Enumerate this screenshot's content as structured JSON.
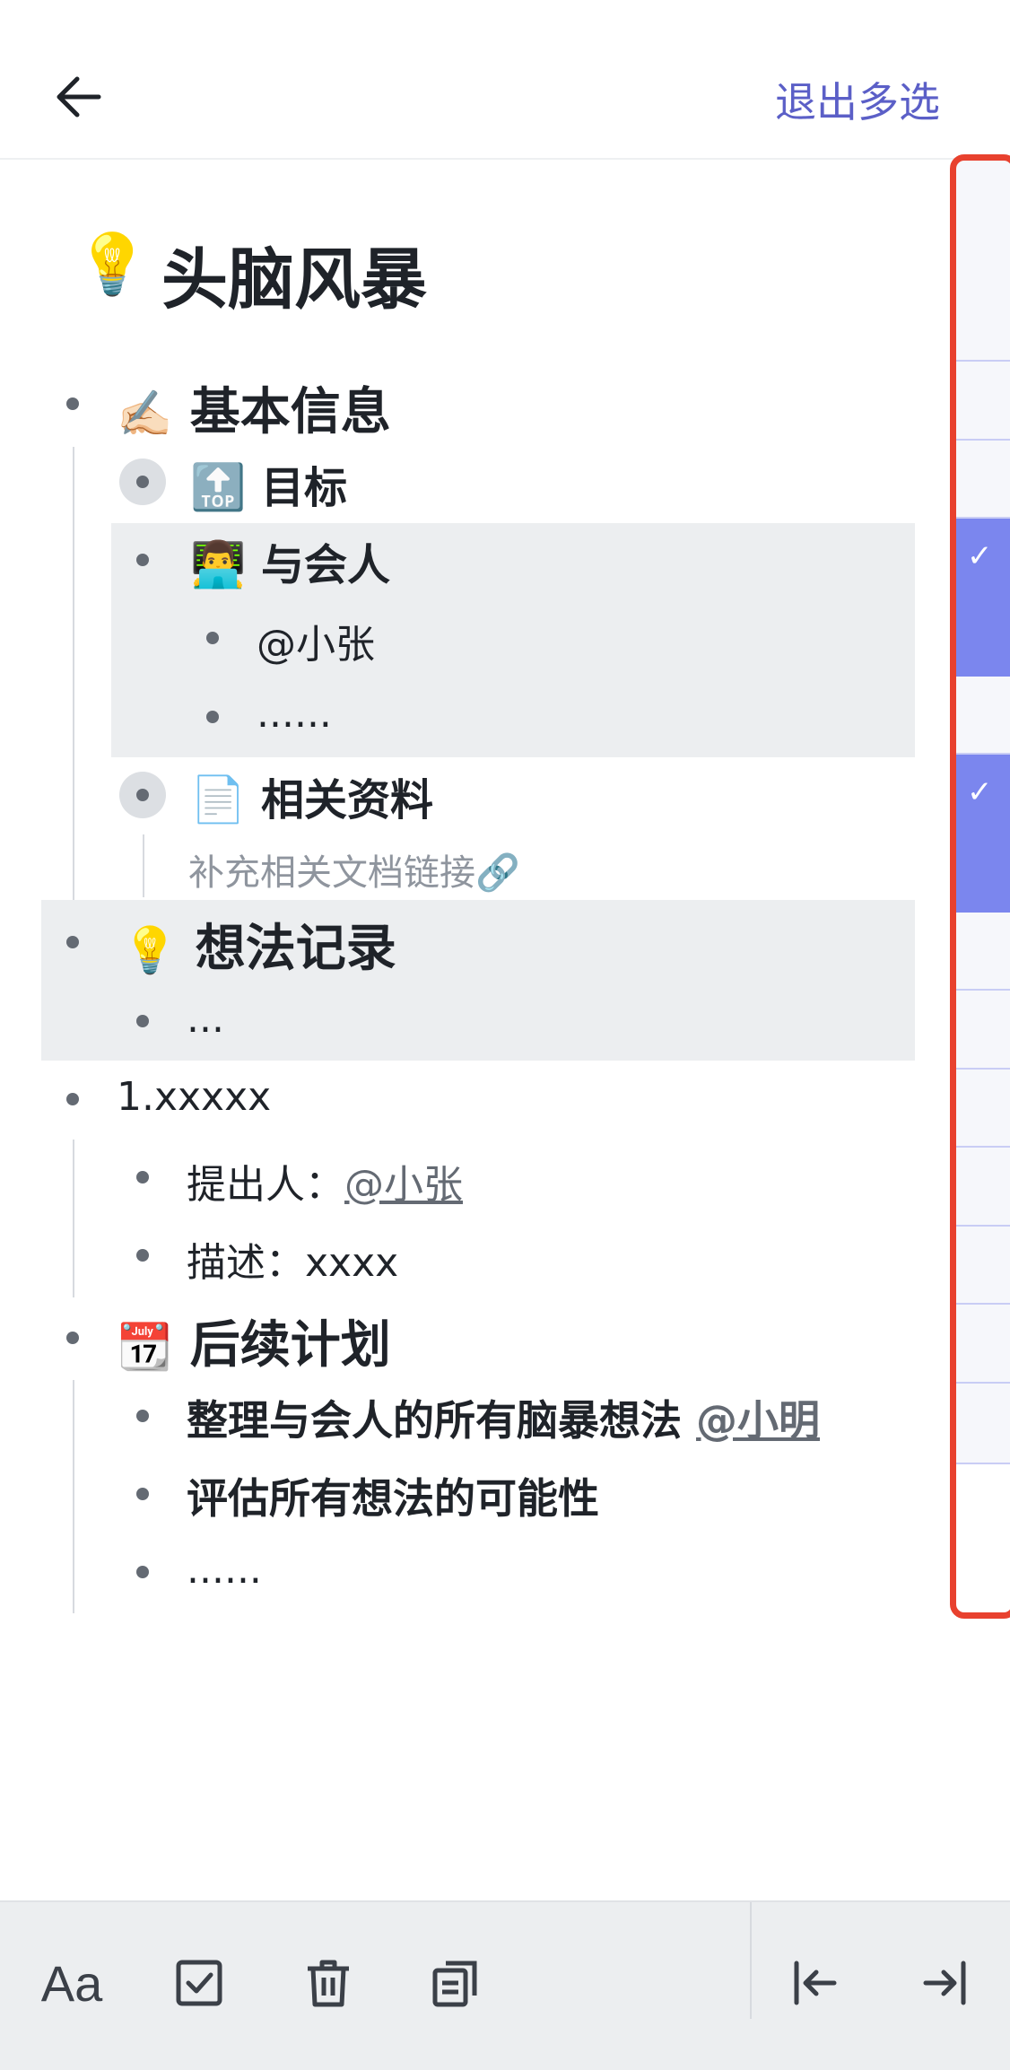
{
  "header": {
    "back_icon": "arrow-left-icon",
    "exit_label": "退出多选"
  },
  "doc": {
    "title_icon": "💡",
    "title": "头脑风暴",
    "sections": {
      "basic": {
        "icon": "✍🏻",
        "label": "基本信息"
      },
      "goal": {
        "icon": "🔝",
        "label": "目标"
      },
      "attendees": {
        "icon": "👨‍💻",
        "label": "与会人"
      },
      "attendee1": "@小张",
      "attendee_more": "......",
      "materials": {
        "icon": "📄",
        "label": "相关资料"
      },
      "materials_hint": "补充相关文档链接🔗",
      "ideas": {
        "icon": "💡",
        "label": "想法记录"
      },
      "ideas_more": "...",
      "idea1": "1.xxxxx",
      "proposer_label": "提出人：",
      "proposer": "@小张",
      "desc_label": "描述：",
      "desc": "xxxx",
      "plan": {
        "icon": "📆",
        "label": "后续计划"
      },
      "plan1_text": "整理与会人的所有脑暴想法 ",
      "plan1_mention": "@小明",
      "plan2": "评估所有想法的可能性",
      "plan_more": "......"
    }
  },
  "selection_column": {
    "cells": [
      {
        "selected": false
      },
      {
        "selected": false
      },
      {
        "selected": false
      },
      {
        "selected": true
      },
      {
        "selected": false
      },
      {
        "selected": true
      },
      {
        "selected": false
      },
      {
        "selected": false
      },
      {
        "selected": false
      },
      {
        "selected": false
      },
      {
        "selected": false
      },
      {
        "selected": false
      },
      {
        "selected": false
      }
    ],
    "check_glyph": "✓"
  },
  "toolbar": {
    "text_style_label": "Aa",
    "items": [
      "text-style-icon",
      "checkbox-icon",
      "trash-icon",
      "copy-icon",
      "outdent-icon",
      "indent-icon"
    ]
  },
  "colors": {
    "accent": "#5b5fc7",
    "selected": "#7b86ee",
    "frame": "#e8412e",
    "highlight": "#eceef0"
  }
}
